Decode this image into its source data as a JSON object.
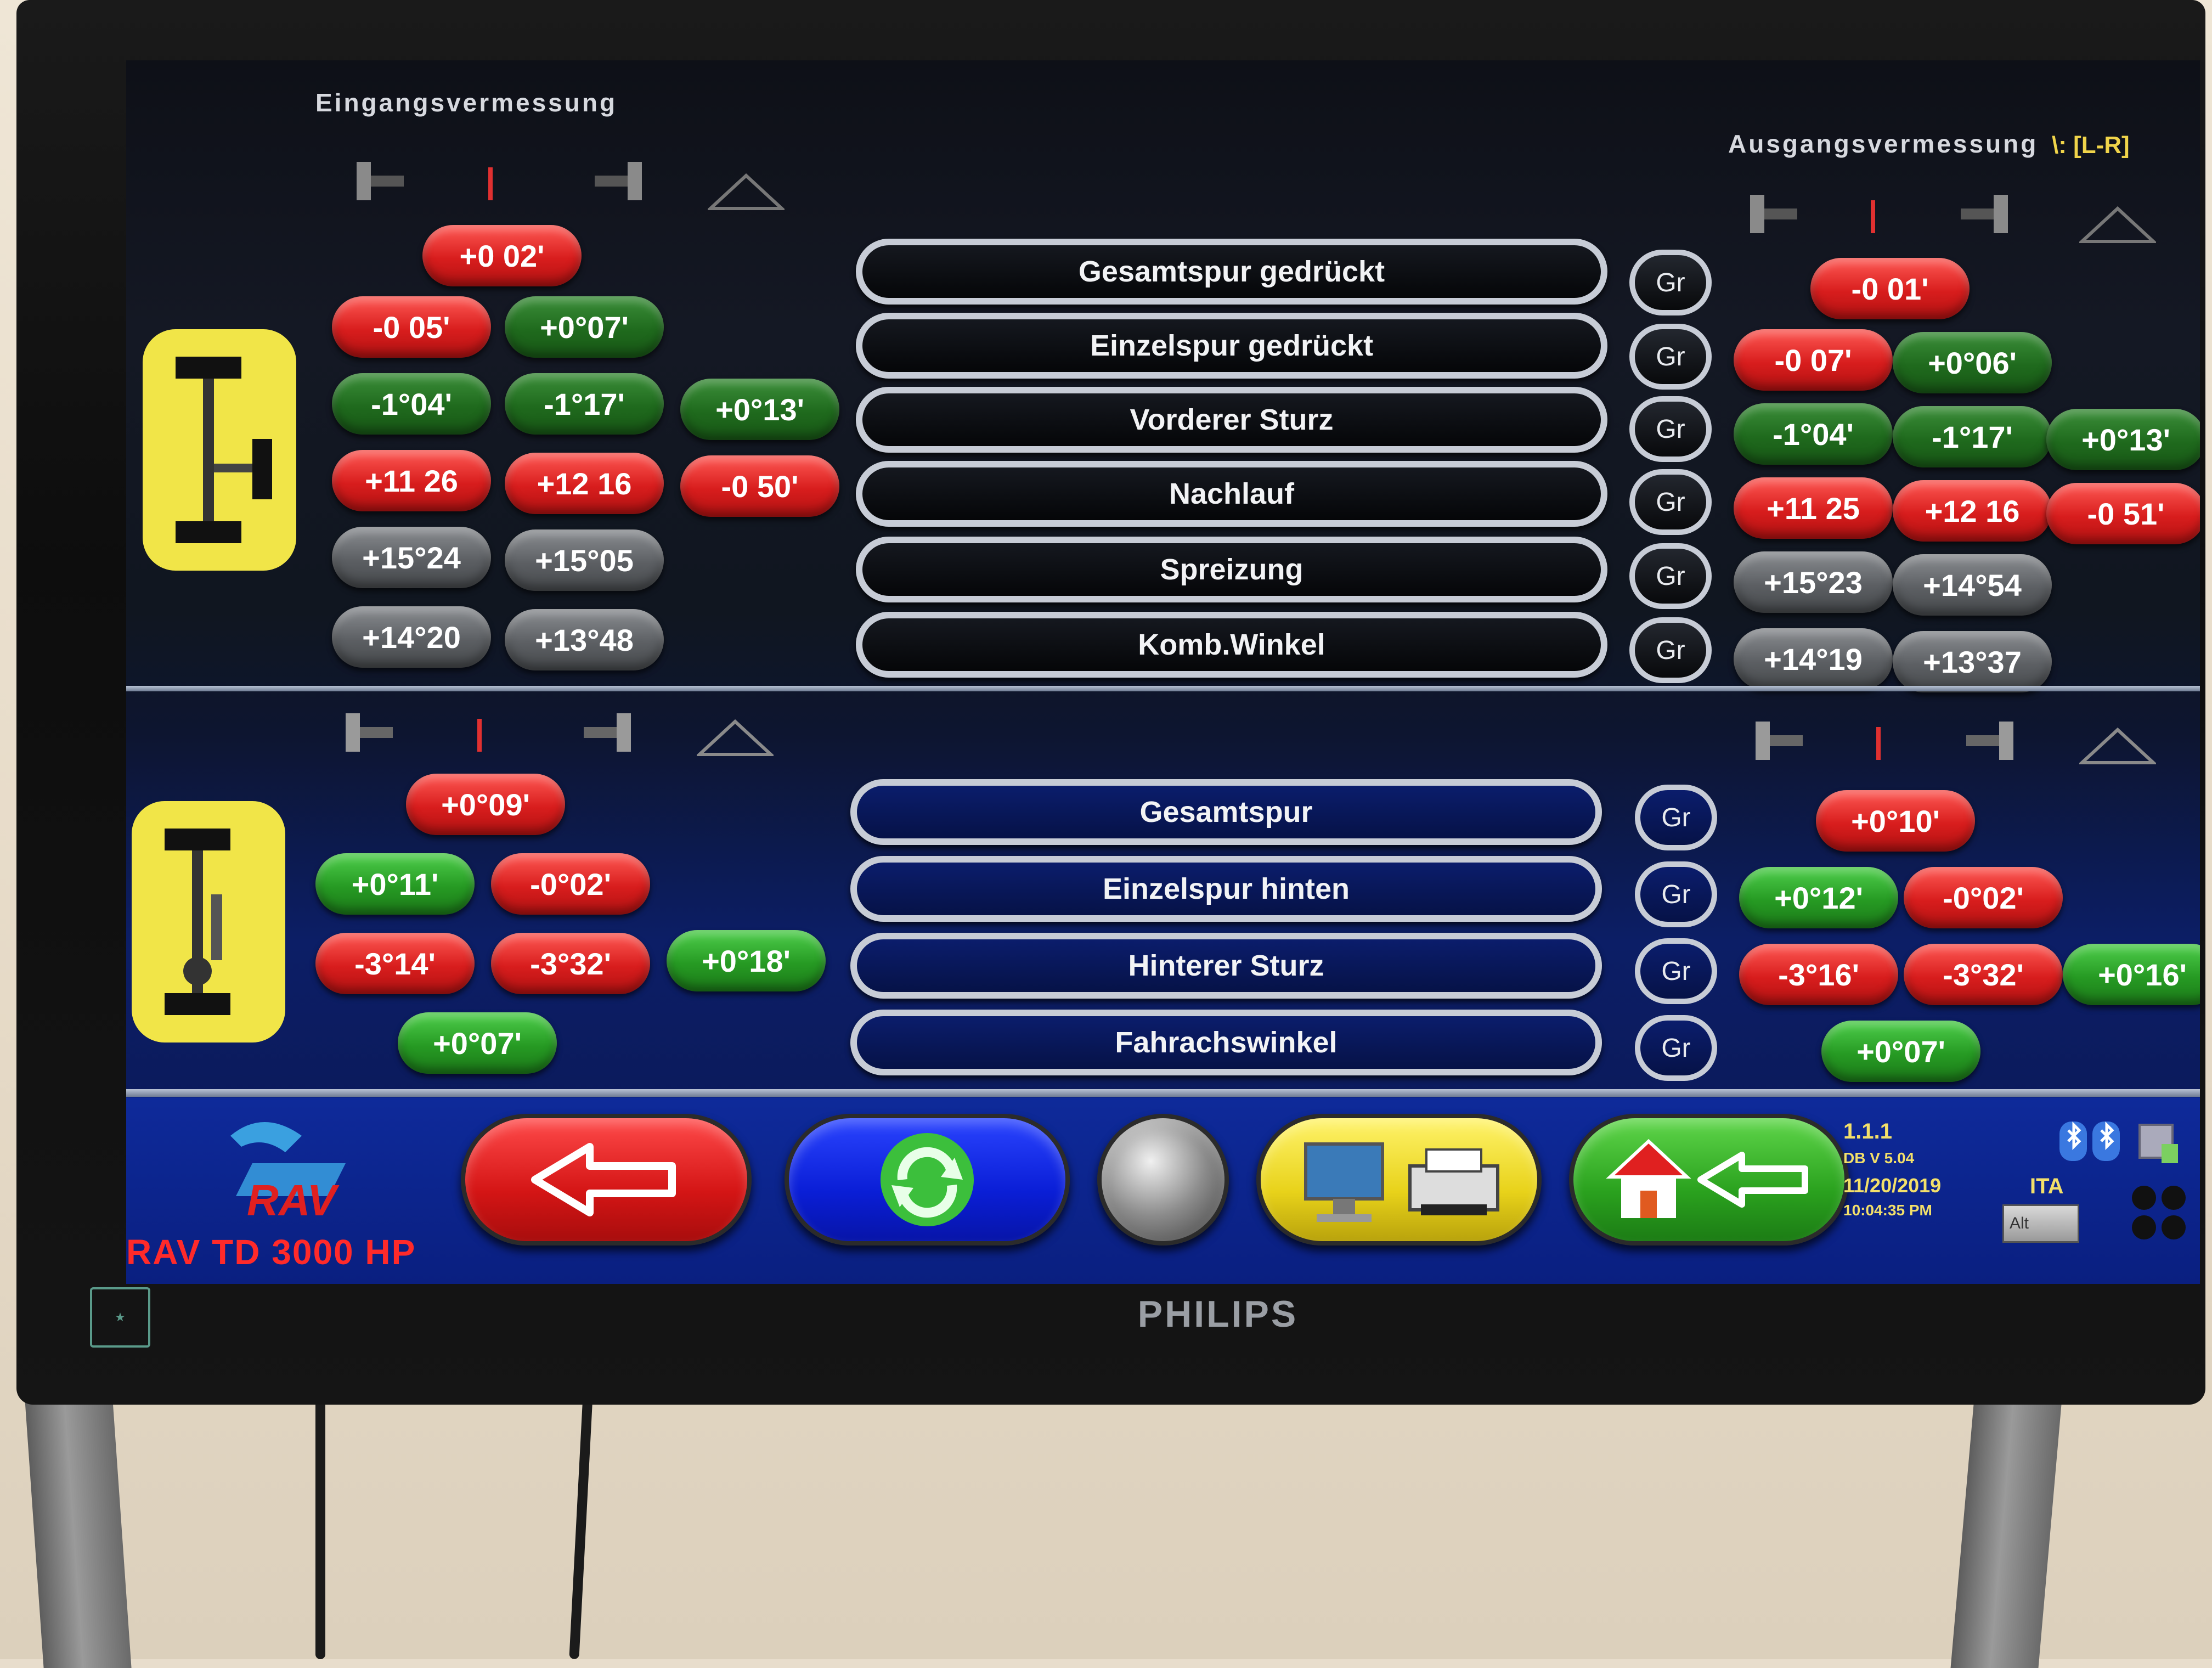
{
  "monitor": {
    "brand": "PHILIPS"
  },
  "screen": {
    "inbound_title": "Eingangsvermessung",
    "outbound_title": "Ausgangsvermessung",
    "mode_indicator": "\\: [L-R]",
    "front_labels": [
      "Gesamtspur gedrückt",
      "Einzelspur gedrückt",
      "Vorderer Sturz",
      "Nachlauf",
      "Spreizung",
      "Komb.Winkel"
    ],
    "rear_labels": [
      "Gesamtspur",
      "Einzelspur hinten",
      "Hinterer Sturz",
      "Fahrachswinkel"
    ],
    "gr_label": "Gr",
    "front_left": {
      "total_toe": "+0 02'",
      "single_toe": [
        "-0 05'",
        "+0°07'"
      ],
      "camber": [
        "-1°04'",
        "-1°17'",
        "+0°13'"
      ],
      "caster": [
        "+11 26",
        "+12 16",
        "-0 50'"
      ],
      "kpi": [
        "+15°24",
        "+15°05"
      ],
      "included": [
        "+14°20",
        "+13°48"
      ]
    },
    "front_right": {
      "total_toe": "-0 01'",
      "single_toe": [
        "-0 07'",
        "+0°06'"
      ],
      "camber": [
        "-1°04'",
        "-1°17'",
        "+0°13'"
      ],
      "caster": [
        "+11 25",
        "+12 16",
        "-0 51'"
      ],
      "kpi": [
        "+15°23",
        "+14°54"
      ],
      "included": [
        "+14°19",
        "+13°37"
      ]
    },
    "rear_left": {
      "total_toe": "+0°09'",
      "single_toe": [
        "+0°11'",
        "-0°02'"
      ],
      "camber": [
        "-3°14'",
        "-3°32'",
        "+0°18'"
      ],
      "thrust": "+0°07'"
    },
    "rear_right": {
      "total_toe": "+0°10'",
      "single_toe": [
        "+0°12'",
        "-0°02'"
      ],
      "camber": [
        "-3°16'",
        "-3°32'",
        "+0°16'"
      ],
      "thrust": "+0°07'"
    },
    "footer": {
      "product": "RAV TD 3000 HP",
      "version": "1.1.1",
      "db_version": "DB V 5.04",
      "date": "11/20/2019",
      "time": "10:04:35 PM",
      "lang": "ITA",
      "alt_key": "Alt"
    },
    "colors": {
      "red": "#d81d1d",
      "green": "#269a23",
      "grey": "#5c5f63",
      "yellow": "#f1e548"
    }
  }
}
